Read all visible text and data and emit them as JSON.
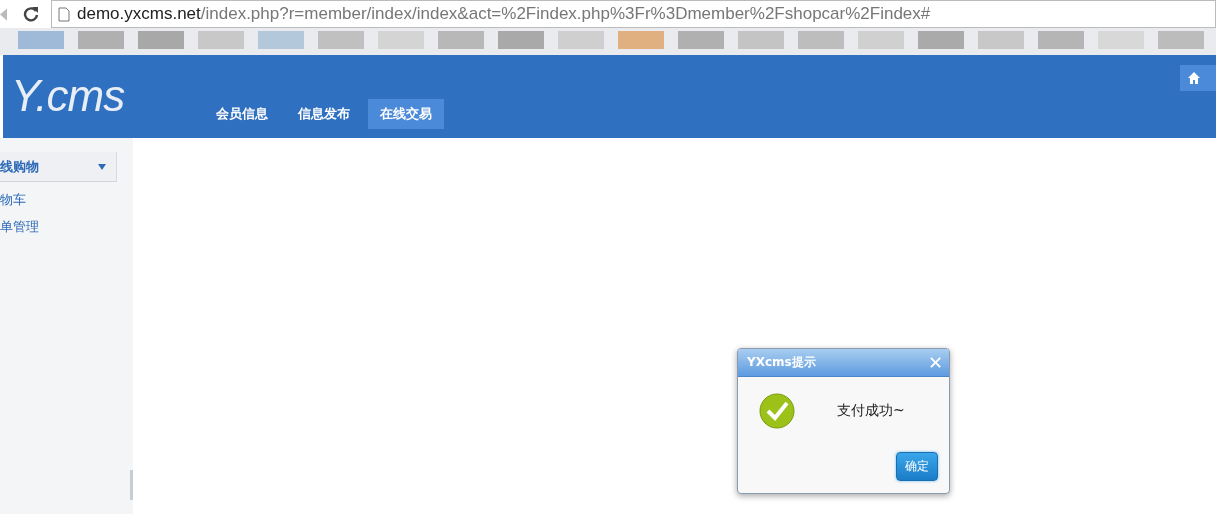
{
  "browser": {
    "url_host": "demo.yxcms.net",
    "url_path": "/index.php?r=member/index/index&act=%2Findex.php%3Fr%3Dmember%2Fshopcar%2Findex#"
  },
  "header": {
    "logo": "Y.cms",
    "nav": [
      {
        "label": "会员信息",
        "selected": false
      },
      {
        "label": "信息发布",
        "selected": false
      },
      {
        "label": "在线交易",
        "selected": true
      }
    ]
  },
  "sidebar": {
    "group": "线购物",
    "items": [
      "物车",
      "单管理"
    ]
  },
  "dialog": {
    "title": "YXcms提示",
    "close": "✕",
    "message": "支付成功~",
    "button": "确定"
  }
}
